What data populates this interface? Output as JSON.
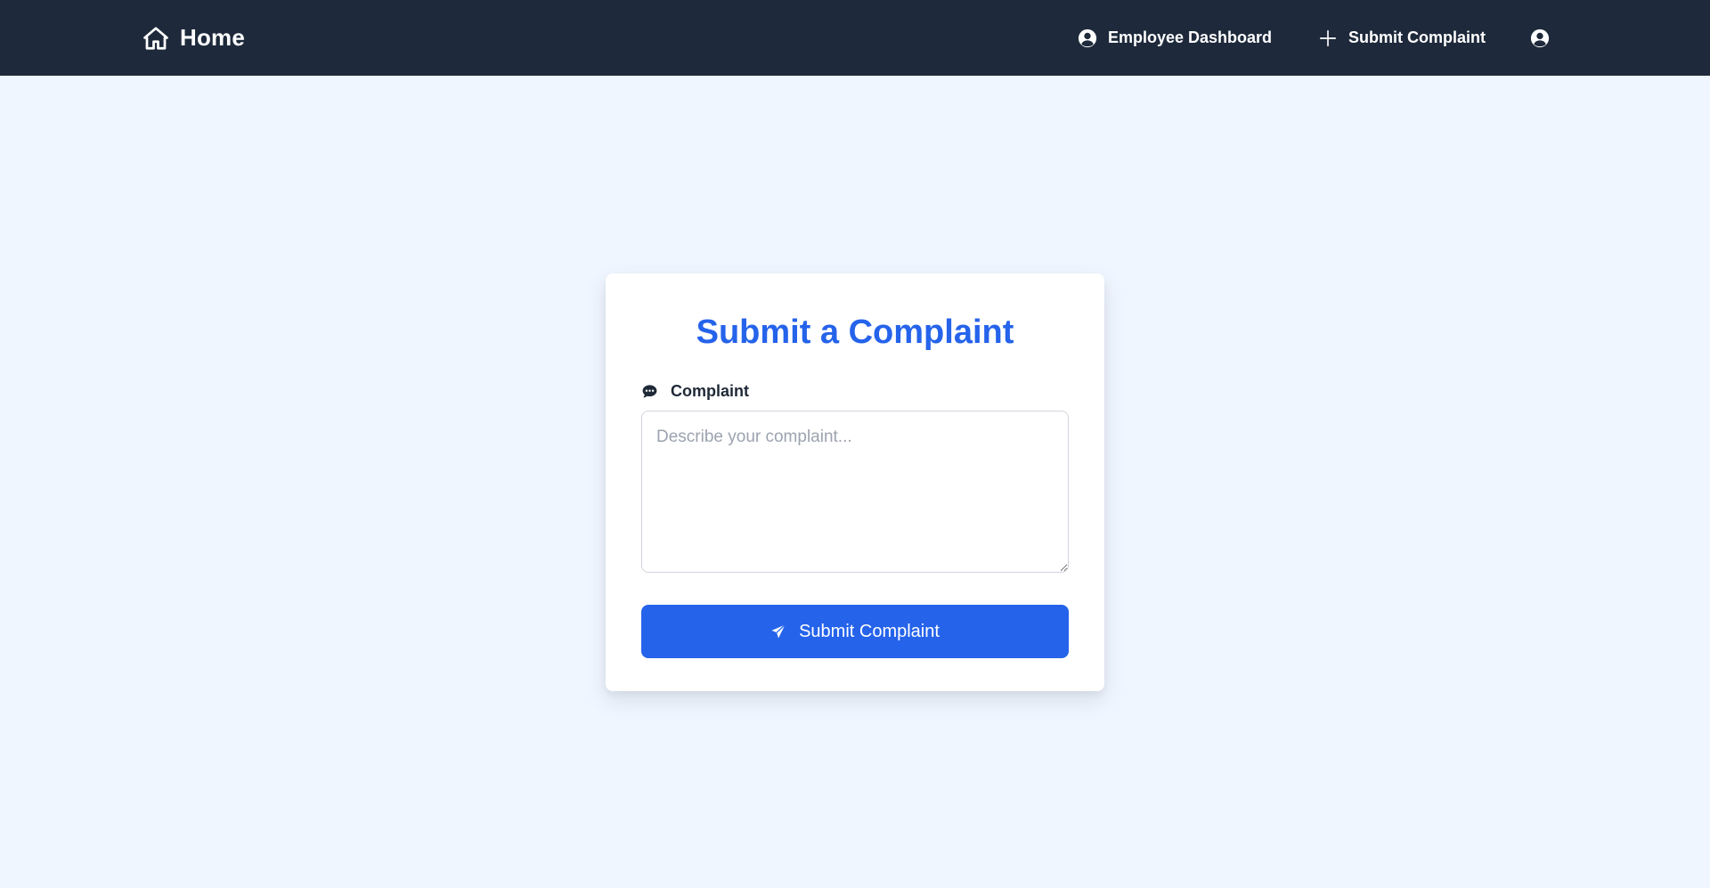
{
  "navbar": {
    "brand": {
      "label": "Home",
      "icon": "home-icon"
    },
    "links": [
      {
        "label": "Employee Dashboard",
        "icon": "user-circle-icon"
      },
      {
        "label": "Submit Complaint",
        "icon": "plus-icon"
      }
    ],
    "profile": {
      "icon": "user-circle-icon"
    }
  },
  "form": {
    "title": "Submit a Complaint",
    "complaint": {
      "label": "Complaint",
      "icon": "comment-dots-icon",
      "placeholder": "Describe your complaint...",
      "value": ""
    },
    "submit": {
      "label": "Submit Complaint",
      "icon": "paper-plane-icon"
    }
  },
  "colors": {
    "navbar_bg": "#1e293b",
    "page_bg": "#eff6ff",
    "accent": "#2563eb",
    "label_text": "#1f2937"
  }
}
